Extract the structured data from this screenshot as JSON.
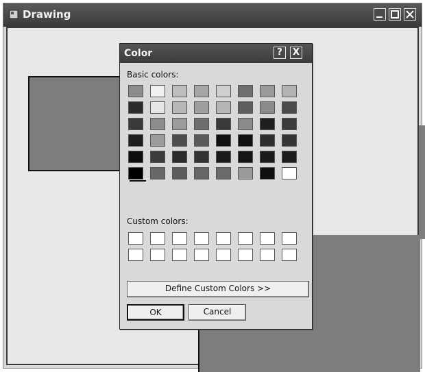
{
  "window": {
    "title": "Drawing",
    "controls": {
      "minimize": "_",
      "maximize": "□",
      "close": "X"
    }
  },
  "dialog": {
    "title": "Color",
    "help_label": "?",
    "close_label": "X",
    "basic_colors_label": "Basic colors:",
    "custom_colors_label": "Custom colors:",
    "define_button": "Define Custom Colors >>",
    "ok_button": "OK",
    "cancel_button": "Cancel",
    "basic_colors": [
      [
        "#8c8c8c",
        "#f0f0f0",
        "#bdbdbd",
        "#a6a6a6",
        "#cfcfcf",
        "#6e6e6e",
        "#9a9a9a",
        "#b3b3b3"
      ],
      [
        "#2c2c2c",
        "#e6e6e6",
        "#b8b8b8",
        "#9e9e9e",
        "#b5b5b5",
        "#5e5e5e",
        "#8a8a8a",
        "#4a4a4a"
      ],
      [
        "#3a3a3a",
        "#8d8d8d",
        "#9b9b9b",
        "#6d6d6d",
        "#3a3a3a",
        "#8a8a8a",
        "#1f1f1f",
        "#3b3b3b"
      ],
      [
        "#1e1e1e",
        "#9c9c9c",
        "#4d4d4d",
        "#5a5a5a",
        "#111111",
        "#111111",
        "#2d2d2d",
        "#343434"
      ],
      [
        "#0e0e0e",
        "#3c3c3c",
        "#2a2a2a",
        "#333333",
        "#1a1a1a",
        "#151515",
        "#1b1b1b",
        "#1c1c1c"
      ],
      [
        "#000000",
        "#676767",
        "#5c5c5c",
        "#666666",
        "#6a6a6a",
        "#9a9a9a",
        "#0f0f0f",
        "#ffffff"
      ]
    ],
    "custom_colors": [
      [
        "#ffffff",
        "#ffffff",
        "#ffffff",
        "#ffffff",
        "#ffffff",
        "#ffffff",
        "#ffffff",
        "#ffffff"
      ],
      [
        "#ffffff",
        "#ffffff",
        "#ffffff",
        "#ffffff",
        "#ffffff",
        "#ffffff",
        "#ffffff",
        "#ffffff"
      ]
    ]
  }
}
